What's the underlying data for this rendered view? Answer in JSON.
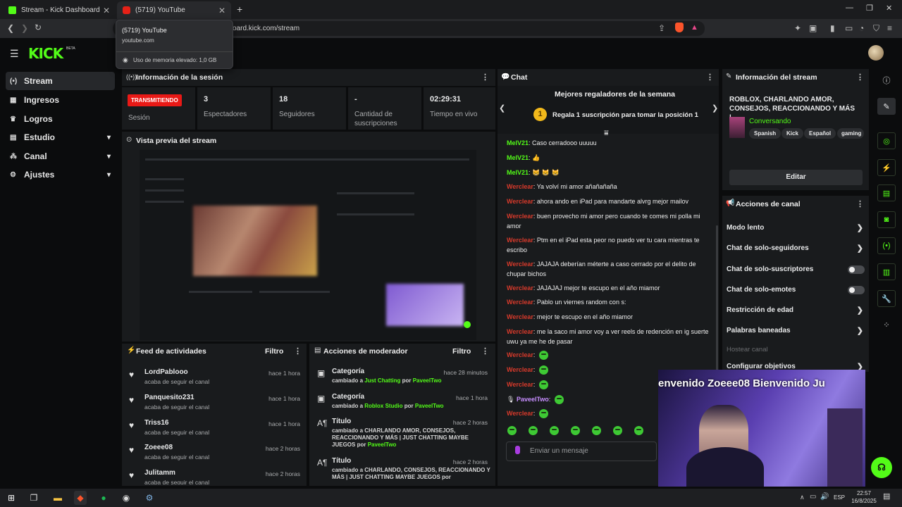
{
  "browser": {
    "tabs": [
      {
        "title": "Stream - Kick Dashboard"
      },
      {
        "title": "(5719) YouTube"
      }
    ],
    "new_tab": "+",
    "url": "oard.kick.com/stream",
    "tooltip": {
      "title": "(5719) YouTube",
      "domain": "youtube.com",
      "memory": "Uso de memoria elevado: 1,0 GB"
    }
  },
  "app": {
    "logo": "KICK",
    "beta": "BETA"
  },
  "sidebar": {
    "items": [
      {
        "label": "Stream",
        "icon": "broadcast-icon"
      },
      {
        "label": "Ingresos",
        "icon": "money-icon"
      },
      {
        "label": "Logros",
        "icon": "trophy-icon"
      },
      {
        "label": "Estudio",
        "icon": "grid-icon"
      },
      {
        "label": "Canal",
        "icon": "channel-icon"
      },
      {
        "label": "Ajustes",
        "icon": "gear-icon"
      }
    ]
  },
  "session": {
    "title": "Información de la sesión",
    "status": "TRANSMITIENDO",
    "status_label": "Sesión",
    "stats": [
      {
        "value": "3",
        "label": "Espectadores"
      },
      {
        "value": "18",
        "label": "Seguidores"
      },
      {
        "value": "-",
        "label": "Cantidad de suscripciones"
      },
      {
        "value": "02:29:31",
        "label": "Tiempo en vivo"
      }
    ]
  },
  "preview": {
    "title": "Vista previa del stream"
  },
  "feed": {
    "title": "Feed de actividades",
    "filter": "Filtro",
    "items": [
      {
        "name": "LordPablooo",
        "sub": "acaba de seguir el canal",
        "time": "hace 1 hora"
      },
      {
        "name": "Panquesito231",
        "sub": "acaba de seguir el canal",
        "time": "hace 1 hora"
      },
      {
        "name": "Triss16",
        "sub": "acaba de seguir el canal",
        "time": "hace 1 hora"
      },
      {
        "name": "Zoeee08",
        "sub": "acaba de seguir el canal",
        "time": "hace 2 horas"
      },
      {
        "name": "Julitamm",
        "sub": "acaba de seguir el canal",
        "time": "hace 2 horas"
      }
    ]
  },
  "mod": {
    "title": "Acciones de moderador",
    "filter": "Filtro",
    "items": [
      {
        "title": "Categoría",
        "pre": "cambiado a ",
        "value": "Just Chatting",
        "by": " por ",
        "user": "PaveelTwo",
        "time": "hace 28 minutos"
      },
      {
        "title": "Categoría",
        "pre": "cambiado a ",
        "value": "Roblox Studio",
        "by": " por ",
        "user": "PaveelTwo",
        "time": "hace 1 hora"
      },
      {
        "title": "Título",
        "pre": "cambiado a ",
        "value": "CHARLANDO AMOR, CONSEJOS, REACCIONANDO Y MÁS | JUST CHATTING MAYBE JUEGOS",
        "by": " por ",
        "user": "PaveelTwo",
        "time": "hace 2 horas"
      },
      {
        "title": "Título",
        "pre": "cambiado a ",
        "value": "CHARLANDO, CONSEJOS, REACCIONANDO Y MÁS | JUST CHATTING MAYBE JUEGOS",
        "by": " por",
        "user": "",
        "time": "hace 2 horas"
      }
    ]
  },
  "chat": {
    "title": "Chat",
    "gifters_title": "Mejores regaladores de la semana",
    "gift_rank": "1",
    "gift_text": "Regala 1 suscripción para tomar la posición 1",
    "input_placeholder": "Enviar un mensaje",
    "messages": [
      {
        "user": "MelV21",
        "text": "Caso cerradooo uuuuu"
      },
      {
        "user": "MelV21",
        "text": "👍"
      },
      {
        "user": "MelV21",
        "text": "😸 😸 😸"
      },
      {
        "user": "Werclear",
        "text": "Ya volví mi amor añañañaña"
      },
      {
        "user": "Werclear",
        "text": "ahora ando en iPad para mandarte alvrg mejor mailov"
      },
      {
        "user": "Werclear",
        "text": "buen provecho mi amor pero cuando te comes mi polla mi amor"
      },
      {
        "user": "Werclear",
        "text": "Ptm en el iPad esta peor no puedo ver tu cara mientras te escribo"
      },
      {
        "user": "Werclear",
        "text": "JAJAJA deberían méterte a caso cerrado por el delito de chupar bichos"
      },
      {
        "user": "Werclear",
        "text": "JAJAJAJ mejor te escupo en el año miamor"
      },
      {
        "user": "Werclear",
        "text": "Pablo un viernes random con s:"
      },
      {
        "user": "Werclear",
        "text": "mejor te escupo en el año miamor"
      },
      {
        "user": "Werclear",
        "text": "me la saco mi amor voy a ver reels de redención en ig suerte uwu ya me he de pasar"
      },
      {
        "user": "Werclear",
        "text": ""
      },
      {
        "user": "Werclear",
        "text": ""
      },
      {
        "user": "Werclear",
        "text": ""
      },
      {
        "user": "PaveelTwo",
        "text": ""
      },
      {
        "user": "Werclear",
        "text": ""
      }
    ]
  },
  "stream_info": {
    "title": "Información del stream",
    "stream_title": "ROBLOX, CHARLANDO AMOR, CONSEJOS, REACCIONANDO Y MÁS |...",
    "category": "Conversando",
    "tags": [
      "Spanish",
      "Kick",
      "Español",
      "gaming"
    ],
    "edit": "Editar"
  },
  "channel_actions": {
    "title": "Acciones de canal",
    "items": [
      {
        "label": "Modo lento",
        "kind": "arrow"
      },
      {
        "label": "Chat de solo-seguidores",
        "kind": "arrow"
      },
      {
        "label": "Chat de solo-suscriptores",
        "kind": "toggle"
      },
      {
        "label": "Chat de solo-emotes",
        "kind": "toggle"
      },
      {
        "label": "Restricción de edad",
        "kind": "arrow"
      },
      {
        "label": "Palabras baneadas",
        "kind": "arrow"
      },
      {
        "label": "Hostear canal",
        "kind": "disabled"
      },
      {
        "label": "Configurar objetivos",
        "kind": "arrow"
      }
    ]
  },
  "webcam": {
    "overlay_text": "envenido Zoeee08    Bienvenido Ju"
  },
  "taskbar": {
    "lang": "ESP",
    "time": "22:57",
    "date": "16/8/2025"
  },
  "colors": {
    "kick_green": "#53fc18",
    "live_red": "#e91916"
  }
}
